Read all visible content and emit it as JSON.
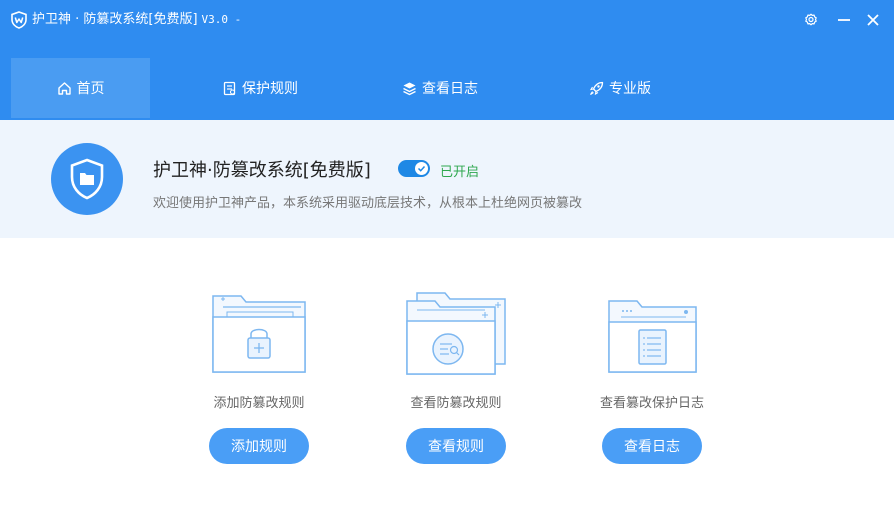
{
  "window": {
    "title": "护卫神 · 防篡改系统[免费版]",
    "version": "V3.0 -"
  },
  "icons": {
    "app": "shield-w-icon",
    "settings": "gear-icon",
    "minimize": "minimize-icon",
    "close": "close-icon"
  },
  "nav": {
    "tabs": [
      {
        "label": "首页",
        "icon": "home-icon",
        "active": true
      },
      {
        "label": "保护规则",
        "icon": "rules-icon",
        "active": false
      },
      {
        "label": "查看日志",
        "icon": "layers-icon",
        "active": false
      },
      {
        "label": "专业版",
        "icon": "rocket-icon",
        "active": false
      }
    ]
  },
  "hero": {
    "title": "护卫神·防篡改系统[免费版]",
    "status": "已开启",
    "enabled": true,
    "description": "欢迎使用护卫神产品，本系统采用驱动底层技术，从根本上杜绝网页被篡改"
  },
  "cards": [
    {
      "label": "添加防篡改规则",
      "button": "添加规则",
      "icon": "folder-lock-icon"
    },
    {
      "label": "查看防篡改规则",
      "button": "查看规则",
      "icon": "folder-search-icon"
    },
    {
      "label": "查看篡改保护日志",
      "button": "查看日志",
      "icon": "browser-document-icon"
    }
  ],
  "colors": {
    "primary": "#2f8cf0",
    "hero_bg": "#eef5fd",
    "button": "#4a9ef6",
    "status": "#2fa84f"
  }
}
